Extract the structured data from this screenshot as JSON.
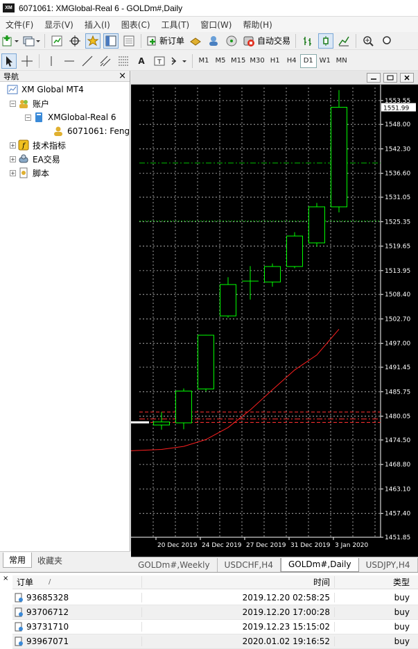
{
  "window": {
    "title": "6071061: XMGlobal-Real 6 - GOLDm#,Daily",
    "logo": "XM"
  },
  "menu": [
    "文件(F)",
    "显示(V)",
    "插入(I)",
    "图表(C)",
    "工具(T)",
    "窗口(W)",
    "帮助(H)"
  ],
  "toolbar": {
    "new_order": "新订单",
    "auto_trade": "自动交易",
    "timeframes": [
      "M1",
      "M5",
      "M15",
      "M30",
      "H1",
      "H4",
      "D1",
      "W1",
      "MN"
    ],
    "selected_timeframe": "D1",
    "text_tool": "A",
    "label_tool": "T"
  },
  "navigator": {
    "title": "导航",
    "close": "×",
    "root": "XM Global MT4",
    "accounts": "账户",
    "server": "XMGlobal-Real 6",
    "account": "6071061: Feng",
    "indicators": "技术指标",
    "experts": "EA交易",
    "scripts": "脚本",
    "tabs": [
      "常用",
      "收藏夹"
    ]
  },
  "chart_tabs": [
    "GOLDm#,Weekly",
    "USDCHF,H4",
    "GOLDm#,Daily",
    "USDJPY,H4"
  ],
  "active_chart_tab": "GOLDm#,Daily",
  "terminal": {
    "close": "×",
    "columns": {
      "order": "订单",
      "sort": "/",
      "time": "时间",
      "type": "类型"
    },
    "rows": [
      {
        "order": "93685328",
        "time": "2019.12.20 02:58:25",
        "type": "buy"
      },
      {
        "order": "93706712",
        "time": "2019.12.20 17:00:28",
        "type": "buy"
      },
      {
        "order": "93731710",
        "time": "2019.12.23 15:15:02",
        "type": "buy"
      },
      {
        "order": "93967071",
        "time": "2020.01.02 19:16:52",
        "type": "buy"
      }
    ]
  },
  "chart_data": {
    "type": "candlestick",
    "symbol": "GOLDm#",
    "timeframe": "Daily",
    "current_price": "1551.99",
    "y_ticks": [
      "1553.55",
      "1548.00",
      "1542.30",
      "1536.60",
      "1531.05",
      "1525.35",
      "1519.65",
      "1513.95",
      "1508.40",
      "1502.70",
      "1497.00",
      "1491.45",
      "1485.75",
      "1480.05",
      "1474.50",
      "1468.80",
      "1463.10",
      "1457.40",
      "1451.85"
    ],
    "ylim": [
      1451.85,
      1556.6
    ],
    "x_ticks": [
      "20 Dec 2019",
      "24 Dec 2019",
      "27 Dec 2019",
      "31 Dec 2019",
      "3 Jan 2020"
    ],
    "candles": [
      {
        "o": 1478.7,
        "h": 1481.0,
        "l": 1476.9,
        "c": 1478.0
      },
      {
        "o": 1478.5,
        "h": 1486.5,
        "l": 1477.0,
        "c": 1485.9
      },
      {
        "o": 1486.4,
        "h": 1499.0,
        "l": 1485.8,
        "c": 1498.9
      },
      {
        "o": 1503.4,
        "h": 1512.4,
        "l": 1503.0,
        "c": 1510.7
      },
      {
        "o": 1511.4,
        "h": 1515.0,
        "l": 1507.2,
        "c": 1511.5
      },
      {
        "o": 1511.3,
        "h": 1515.6,
        "l": 1510.2,
        "c": 1514.9
      },
      {
        "o": 1514.9,
        "h": 1522.9,
        "l": 1514.5,
        "c": 1522.0
      },
      {
        "o": 1520.4,
        "h": 1529.7,
        "l": 1519.5,
        "c": 1528.8
      },
      {
        "o": 1528.8,
        "h": 1556.0,
        "l": 1527.5,
        "c": 1551.99
      }
    ],
    "ma_series": [
      1472.3,
      1473.0,
      1474.6,
      1477.4,
      1481.5,
      1486.2,
      1490.8,
      1494.3,
      1500.3
    ],
    "level_lines": [
      {
        "price": 1539.0,
        "color": "#00c000",
        "style": "dash-dot"
      },
      {
        "price": 1525.5,
        "color": "#00c000",
        "style": "dotted"
      },
      {
        "price": 1481.0,
        "color": "#ff3030",
        "style": "dashed"
      },
      {
        "price": 1479.4,
        "color": "#ff3030",
        "style": "dash-dot"
      },
      {
        "price": 1478.6,
        "color": "#ff3030",
        "style": "dashed"
      }
    ],
    "colors": {
      "background": "#000000",
      "grid": "#c8c8c8",
      "candle": "#00ff00",
      "ma": "#ff2020",
      "axis_text": "#ffffff"
    }
  }
}
